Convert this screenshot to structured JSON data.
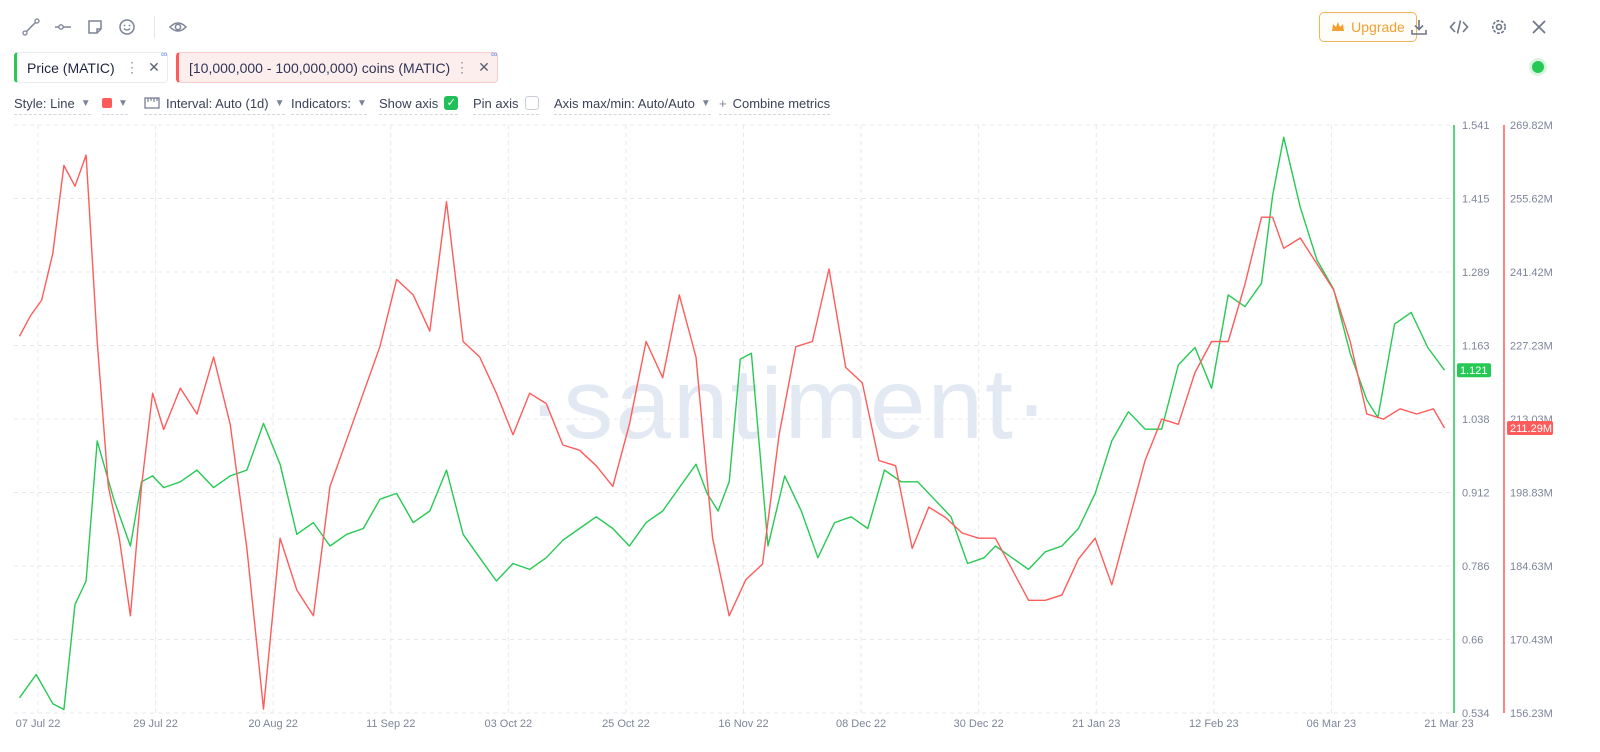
{
  "toolbar": {
    "icons": [
      "draw-line-icon",
      "horizontal-ray-icon",
      "note-icon",
      "emoji-icon",
      "eye-icon"
    ],
    "upgrade_label": "Upgrade",
    "right_icons": [
      "download-icon",
      "embed-code-icon",
      "settings-gear-icon",
      "close-icon"
    ]
  },
  "metrics": [
    {
      "label": "Price (MATIC)",
      "color": "#26c953"
    },
    {
      "label": "[10,000,000 - 100,000,000) coins (MATIC)",
      "color": "#ff5b5b"
    }
  ],
  "settings": {
    "style": "Style: Line",
    "interval": "Interval: Auto (1d)",
    "indicators": "Indicators:",
    "show_axis": "Show axis",
    "show_axis_checked": true,
    "pin_axis": "Pin axis",
    "pin_axis_checked": false,
    "axis_maxmin": "Axis max/min: Auto/Auto",
    "combine": "Combine metrics"
  },
  "watermark": "·santiment·",
  "chart_data": {
    "type": "line",
    "x_ticks": [
      "07 Jul 22",
      "29 Jul 22",
      "20 Aug 22",
      "11 Sep 22",
      "03 Oct 22",
      "25 Oct 22",
      "16 Nov 22",
      "08 Dec 22",
      "30 Dec 22",
      "21 Jan 23",
      "12 Feb 23",
      "06 Mar 23",
      "21 Mar 23"
    ],
    "y_right_ticks": [
      "1.541",
      "1.415",
      "1.289",
      "1.163",
      "1.038",
      "0.912",
      "0.786",
      "0.66",
      "0.534"
    ],
    "y_right2_ticks": [
      "269.82M",
      "255.62M",
      "241.42M",
      "227.23M",
      "213.03M",
      "198.83M",
      "184.63M",
      "170.43M",
      "156.23M"
    ],
    "ylim_price": [
      0.534,
      1.541
    ],
    "ylim_coins_millions": [
      156.23,
      269.82
    ],
    "grid": true,
    "series": [
      {
        "name": "Price (MATIC)",
        "color": "#26c953",
        "last_label": "1.121",
        "x": [
          "2022-07-07",
          "2022-07-10",
          "2022-07-13",
          "2022-07-15",
          "2022-07-17",
          "2022-07-19",
          "2022-07-21",
          "2022-07-24",
          "2022-07-27",
          "2022-07-29",
          "2022-07-31",
          "2022-08-02",
          "2022-08-05",
          "2022-08-08",
          "2022-08-11",
          "2022-08-14",
          "2022-08-17",
          "2022-08-20",
          "2022-08-23",
          "2022-08-26",
          "2022-08-29",
          "2022-09-01",
          "2022-09-04",
          "2022-09-07",
          "2022-09-10",
          "2022-09-13",
          "2022-09-16",
          "2022-09-19",
          "2022-09-22",
          "2022-09-25",
          "2022-09-28",
          "2022-10-01",
          "2022-10-04",
          "2022-10-07",
          "2022-10-10",
          "2022-10-13",
          "2022-10-16",
          "2022-10-19",
          "2022-10-22",
          "2022-10-25",
          "2022-10-28",
          "2022-10-31",
          "2022-11-03",
          "2022-11-06",
          "2022-11-08",
          "2022-11-10",
          "2022-11-12",
          "2022-11-14",
          "2022-11-16",
          "2022-11-19",
          "2022-11-22",
          "2022-11-25",
          "2022-11-28",
          "2022-12-01",
          "2022-12-04",
          "2022-12-07",
          "2022-12-10",
          "2022-12-13",
          "2022-12-16",
          "2022-12-19",
          "2022-12-22",
          "2022-12-25",
          "2022-12-28",
          "2022-12-30",
          "2023-01-02",
          "2023-01-05",
          "2023-01-08",
          "2023-01-11",
          "2023-01-14",
          "2023-01-17",
          "2023-01-20",
          "2023-01-23",
          "2023-01-26",
          "2023-01-29",
          "2023-02-01",
          "2023-02-04",
          "2023-02-07",
          "2023-02-10",
          "2023-02-13",
          "2023-02-16",
          "2023-02-18",
          "2023-02-20",
          "2023-02-23",
          "2023-02-26",
          "2023-03-01",
          "2023-03-04",
          "2023-03-07",
          "2023-03-09",
          "2023-03-12",
          "2023-03-15",
          "2023-03-18",
          "2023-03-21"
        ],
        "values": [
          0.56,
          0.6,
          0.55,
          0.54,
          0.72,
          0.76,
          1.0,
          0.9,
          0.82,
          0.93,
          0.94,
          0.92,
          0.93,
          0.95,
          0.92,
          0.94,
          0.95,
          1.03,
          0.96,
          0.84,
          0.86,
          0.82,
          0.84,
          0.85,
          0.9,
          0.91,
          0.86,
          0.88,
          0.95,
          0.84,
          0.8,
          0.76,
          0.79,
          0.78,
          0.8,
          0.83,
          0.85,
          0.87,
          0.85,
          0.82,
          0.86,
          0.88,
          0.92,
          0.96,
          0.91,
          0.88,
          0.93,
          1.14,
          1.15,
          0.82,
          0.94,
          0.88,
          0.8,
          0.86,
          0.87,
          0.85,
          0.95,
          0.93,
          0.93,
          0.9,
          0.87,
          0.79,
          0.8,
          0.82,
          0.8,
          0.78,
          0.81,
          0.82,
          0.85,
          0.91,
          1.0,
          1.05,
          1.02,
          1.02,
          1.13,
          1.16,
          1.09,
          1.25,
          1.23,
          1.27,
          1.42,
          1.52,
          1.4,
          1.31,
          1.26,
          1.15,
          1.07,
          1.04,
          1.2,
          1.22,
          1.16,
          1.121
        ]
      },
      {
        "name": "[10,000,000 - 100,000,000) coins (MATIC)",
        "color": "#ff5b5b",
        "last_label": "211.29M",
        "x": [
          "2022-07-07",
          "2022-07-09",
          "2022-07-11",
          "2022-07-13",
          "2022-07-15",
          "2022-07-17",
          "2022-07-19",
          "2022-07-21",
          "2022-07-23",
          "2022-07-25",
          "2022-07-27",
          "2022-07-29",
          "2022-07-31",
          "2022-08-02",
          "2022-08-05",
          "2022-08-08",
          "2022-08-11",
          "2022-08-14",
          "2022-08-17",
          "2022-08-20",
          "2022-08-23",
          "2022-08-26",
          "2022-08-29",
          "2022-09-01",
          "2022-09-04",
          "2022-09-07",
          "2022-09-10",
          "2022-09-13",
          "2022-09-16",
          "2022-09-19",
          "2022-09-22",
          "2022-09-25",
          "2022-09-28",
          "2022-10-01",
          "2022-10-04",
          "2022-10-07",
          "2022-10-10",
          "2022-10-13",
          "2022-10-16",
          "2022-10-19",
          "2022-10-22",
          "2022-10-25",
          "2022-10-28",
          "2022-10-31",
          "2022-11-03",
          "2022-11-06",
          "2022-11-09",
          "2022-11-12",
          "2022-11-15",
          "2022-11-18",
          "2022-11-21",
          "2022-11-24",
          "2022-11-27",
          "2022-11-30",
          "2022-12-03",
          "2022-12-06",
          "2022-12-09",
          "2022-12-12",
          "2022-12-15",
          "2022-12-18",
          "2022-12-21",
          "2022-12-24",
          "2022-12-27",
          "2022-12-30",
          "2023-01-02",
          "2023-01-05",
          "2023-01-08",
          "2023-01-11",
          "2023-01-14",
          "2023-01-17",
          "2023-01-20",
          "2023-01-23",
          "2023-01-26",
          "2023-01-29",
          "2023-02-01",
          "2023-02-04",
          "2023-02-07",
          "2023-02-10",
          "2023-02-13",
          "2023-02-16",
          "2023-02-18",
          "2023-02-20",
          "2023-02-23",
          "2023-02-26",
          "2023-03-01",
          "2023-03-04",
          "2023-03-07",
          "2023-03-10",
          "2023-03-13",
          "2023-03-16",
          "2023-03-19",
          "2023-03-21"
        ],
        "values": [
          229,
          233,
          236,
          245,
          262,
          258,
          264,
          228,
          200,
          190,
          175,
          200,
          218,
          211,
          219,
          214,
          225,
          212,
          188,
          157,
          190,
          180,
          175,
          200,
          209,
          218,
          227,
          240,
          237,
          230,
          255,
          228,
          225,
          218,
          210,
          218,
          216,
          208,
          207,
          204,
          200,
          212,
          228,
          221,
          237,
          225,
          190,
          175,
          182,
          185,
          210,
          227,
          228,
          242,
          223,
          220,
          205,
          204,
          188,
          196,
          194,
          191,
          190,
          190,
          184,
          178,
          178,
          179,
          186,
          190,
          181,
          193,
          205,
          213,
          212,
          222,
          228,
          228,
          239,
          252,
          252,
          246,
          248,
          243,
          238,
          228,
          214,
          213,
          215,
          214,
          215,
          211.29
        ]
      }
    ]
  }
}
